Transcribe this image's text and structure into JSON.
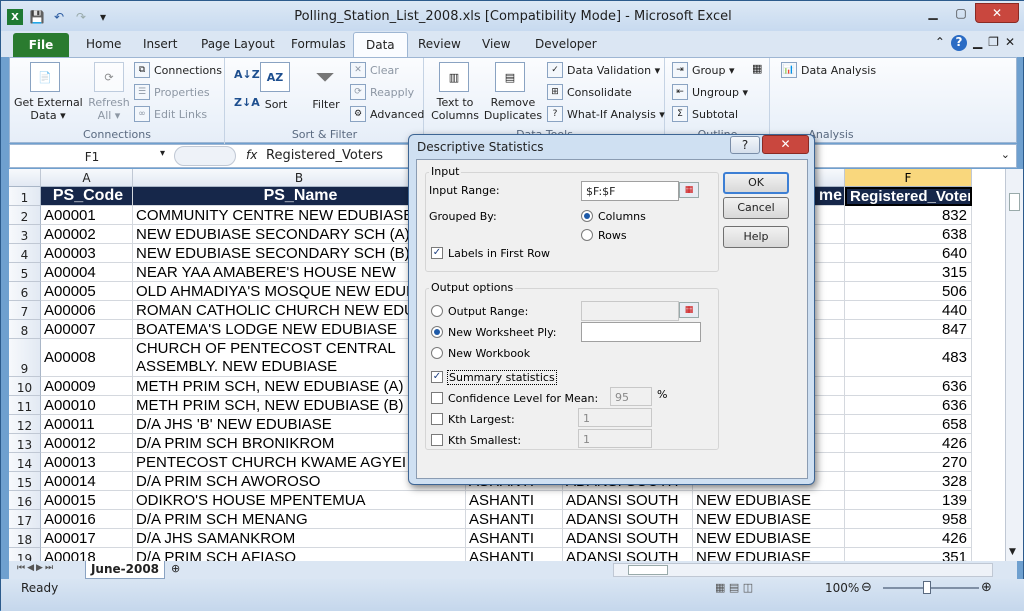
{
  "window": {
    "title": "Polling_Station_List_2008.xls  [Compatibility Mode]  -  Microsoft Excel"
  },
  "tabs": [
    "File",
    "Home",
    "Insert",
    "Page Layout",
    "Formulas",
    "Data",
    "Review",
    "View",
    "Developer"
  ],
  "ribbon": {
    "get_external": "Get External\nData ▾",
    "refresh": "Refresh\nAll ▾",
    "connections": "Connections",
    "properties": "Properties",
    "edit_links": "Edit Links",
    "group_connections": "Connections",
    "sort": "Sort",
    "filter": "Filter",
    "clear": "Clear",
    "reapply": "Reapply",
    "advanced": "Advanced",
    "group_sortfilter": "Sort & Filter",
    "text_to_columns": "Text to\nColumns",
    "remove_duplicates": "Remove\nDuplicates",
    "data_validation": "Data Validation ▾",
    "consolidate": "Consolidate",
    "whatif": "What-If Analysis ▾",
    "group_datatools": "Data Tools",
    "group_btn": "Group ▾",
    "ungroup": "Ungroup ▾",
    "subtotal": "Subtotal",
    "group_outline": "Outline",
    "data_analysis": "Data Analysis",
    "group_analysis": "Analysis"
  },
  "formula_bar": {
    "name_box": "F1",
    "fx": "fx",
    "content": "Registered_Voters"
  },
  "columns": [
    "A",
    "B",
    "C",
    "D",
    "E",
    "F"
  ],
  "rows": [
    {
      "n": "1",
      "a": "PS_Code",
      "b": "PS_Name",
      "c": "",
      "d": "",
      "e": "me",
      "f": "Registered_Voters"
    },
    {
      "n": "2",
      "a": "A00001",
      "b": "COMMUNITY CENTRE NEW EDUBIASE",
      "c": "",
      "d": "",
      "e": "",
      "f": "832"
    },
    {
      "n": "3",
      "a": "A00002",
      "b": "NEW EDUBIASE SECONDARY SCH (A)",
      "c": "",
      "d": "",
      "e": "",
      "f": "638"
    },
    {
      "n": "4",
      "a": "A00003",
      "b": "NEW EDUBIASE SECONDARY SCH (B)",
      "c": "",
      "d": "",
      "e": "",
      "f": "640"
    },
    {
      "n": "5",
      "a": "A00004",
      "b": "NEAR YAA AMABERE'S HOUSE NEW",
      "c": "",
      "d": "",
      "e": "",
      "f": "315"
    },
    {
      "n": "6",
      "a": "A00005",
      "b": "OLD AHMADIYA'S MOSQUE NEW EDUB",
      "c": "",
      "d": "",
      "e": "",
      "f": "506"
    },
    {
      "n": "7",
      "a": "A00006",
      "b": "ROMAN CATHOLIC CHURCH  NEW EDU",
      "c": "",
      "d": "",
      "e": "",
      "f": "440"
    },
    {
      "n": "8",
      "a": "A00007",
      "b": "BOATEMA'S LODGE NEW EDUBIASE",
      "c": "",
      "d": "",
      "e": "",
      "f": "847"
    },
    {
      "n": "9",
      "a": "A00008",
      "b": "CHURCH OF PENTECOST CENTRAL ASSEMBLY. NEW EDUBIASE",
      "c": "",
      "d": "",
      "e": "",
      "f": "483"
    },
    {
      "n": "10",
      "a": "A00009",
      "b": "METH PRIM SCH, NEW EDUBIASE (A)",
      "c": "",
      "d": "",
      "e": "",
      "f": "636"
    },
    {
      "n": "11",
      "a": "A00010",
      "b": "METH PRIM SCH, NEW EDUBIASE (B)",
      "c": "",
      "d": "",
      "e": "",
      "f": "636"
    },
    {
      "n": "12",
      "a": "A00011",
      "b": "D/A  JHS 'B' NEW EDUBIASE",
      "c": "",
      "d": "",
      "e": "",
      "f": "658"
    },
    {
      "n": "13",
      "a": "A00012",
      "b": "D/A PRIM SCH BRONIKROM",
      "c": "",
      "d": "",
      "e": "",
      "f": "426"
    },
    {
      "n": "14",
      "a": "A00013",
      "b": "PENTECOST CHURCH KWAME AGYEI",
      "c": "",
      "d": "",
      "e": "",
      "f": "270"
    },
    {
      "n": "15",
      "a": "A00014",
      "b": "D/A PRIM SCH AWOROSO",
      "c": "ASHANTI",
      "d": "ADANSI SOUTH",
      "e": "",
      "f": "328"
    },
    {
      "n": "16",
      "a": "A00015",
      "b": "ODIKRO'S HOUSE MPENTEMUA",
      "c": "ASHANTI",
      "d": "ADANSI SOUTH",
      "e": "NEW EDUBIASE",
      "f": "139"
    },
    {
      "n": "17",
      "a": "A00016",
      "b": "D/A PRIM SCH MENANG",
      "c": "ASHANTI",
      "d": "ADANSI SOUTH",
      "e": "NEW EDUBIASE",
      "f": "958"
    },
    {
      "n": "18",
      "a": "A00017",
      "b": "D/A JHS SAMANKROM",
      "c": "ASHANTI",
      "d": "ADANSI SOUTH",
      "e": "NEW EDUBIASE",
      "f": "426"
    },
    {
      "n": "19",
      "a": "A00018",
      "b": "D/A PRIM SCH AFIASO",
      "c": "ASHANTI",
      "d": "ADANSI SOUTH",
      "e": "NEW EDUBIASE",
      "f": "351"
    }
  ],
  "sheet_tab": "June-2008",
  "status": {
    "ready": "Ready",
    "zoom": "100%"
  },
  "dialog": {
    "title": "Descriptive Statistics",
    "help_q": "?",
    "input_group": "Input",
    "input_range_label": "Input Range:",
    "input_range_value": "$F:$F",
    "grouped_by": "Grouped By:",
    "columns": "Columns",
    "rows": "Rows",
    "labels_first_row": "Labels in First Row",
    "output_group": "Output options",
    "output_range": "Output Range:",
    "new_ws": "New Worksheet Ply:",
    "new_wb": "New Workbook",
    "summary": "Summary statistics",
    "confidence": "Confidence Level for Mean:",
    "confidence_value": "95",
    "percent": "%",
    "kth_largest": "Kth Largest:",
    "kth_largest_value": "1",
    "kth_smallest": "Kth Smallest:",
    "kth_smallest_value": "1",
    "ok": "OK",
    "cancel": "Cancel",
    "help": "Help"
  }
}
